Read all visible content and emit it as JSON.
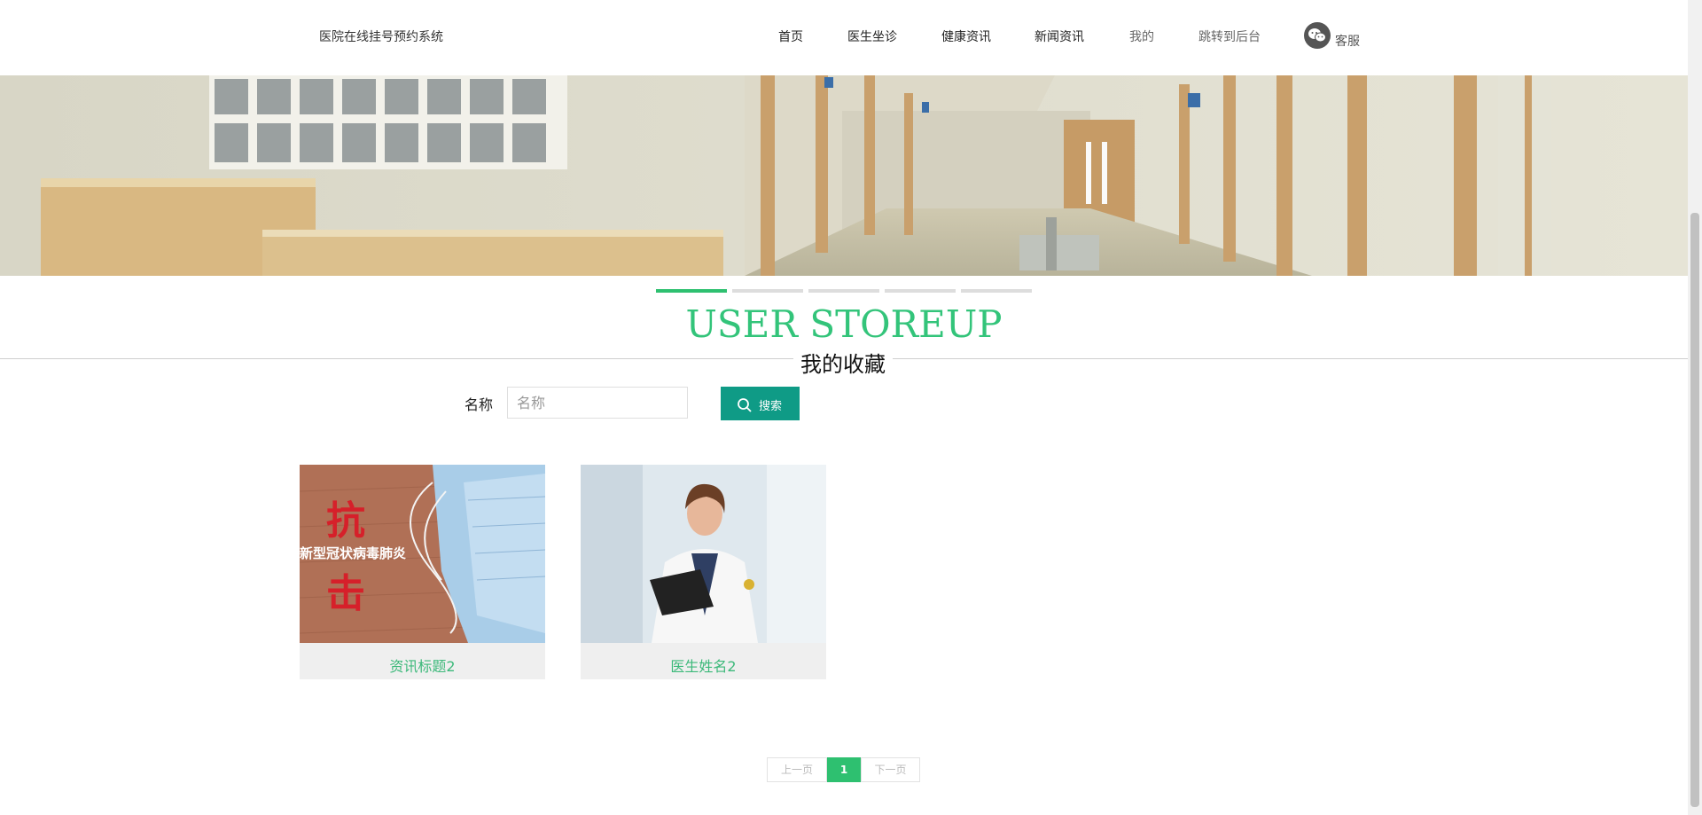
{
  "header": {
    "site_title": "医院在线挂号预约系统",
    "nav": [
      {
        "label": "首页"
      },
      {
        "label": "医生坐诊"
      },
      {
        "label": "健康资讯"
      },
      {
        "label": "新闻资讯"
      },
      {
        "label": "我的"
      },
      {
        "label": "跳转到后台"
      }
    ],
    "service_label": "客服"
  },
  "section": {
    "title_en": "USER STOREUP",
    "title_cn": "我的收藏"
  },
  "search": {
    "label": "名称",
    "placeholder": "名称",
    "value": "",
    "button_label": "搜索"
  },
  "cards": [
    {
      "title": "资讯标题2",
      "image_text": "新型冠状病毒肺炎",
      "image_chars": [
        "抗",
        "击"
      ]
    },
    {
      "title": "医生姓名2"
    }
  ],
  "pagination": {
    "prev": "上一页",
    "current": "1",
    "next": "下一页"
  },
  "colors": {
    "accent": "#2ec070",
    "button": "#0f9b86",
    "card_title": "#3cb97a"
  }
}
